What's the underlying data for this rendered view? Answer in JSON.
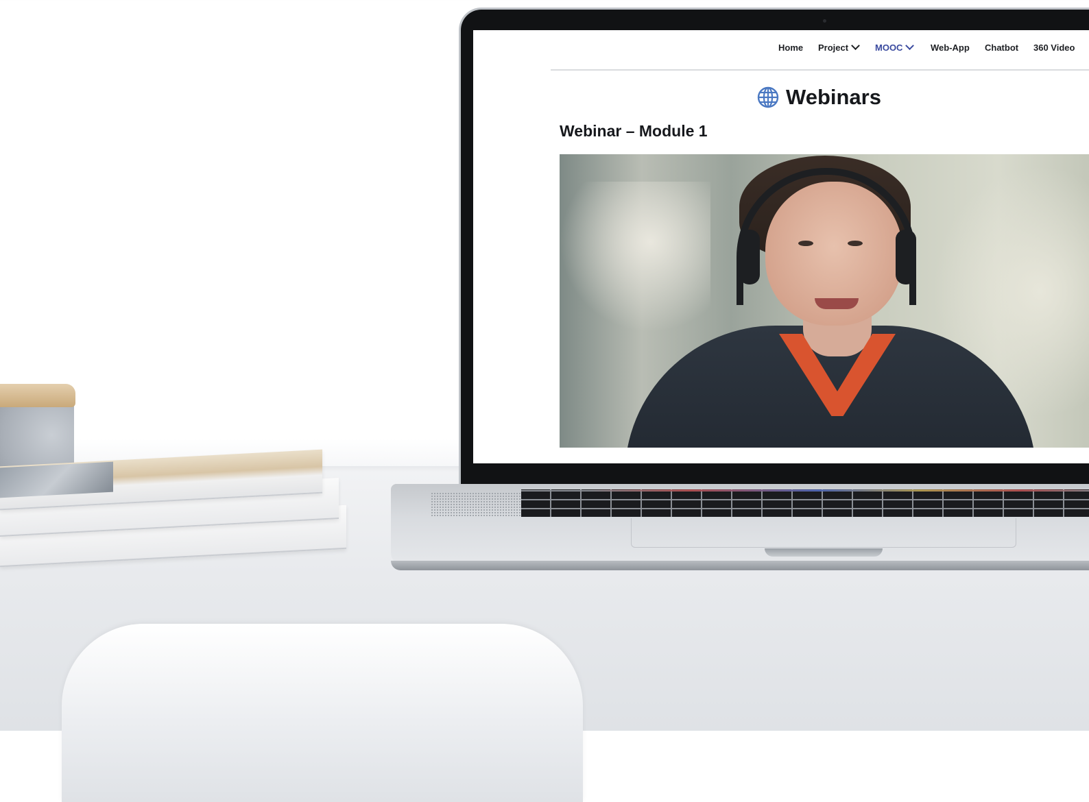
{
  "nav": {
    "items": [
      {
        "label": "Home",
        "has_dropdown": false,
        "active": false
      },
      {
        "label": "Project",
        "has_dropdown": true,
        "active": false
      },
      {
        "label": "MOOC",
        "has_dropdown": true,
        "active": true
      },
      {
        "label": "Web-App",
        "has_dropdown": false,
        "active": false
      },
      {
        "label": "Chatbot",
        "has_dropdown": false,
        "active": false
      },
      {
        "label": "360 Video",
        "has_dropdown": false,
        "active": false
      }
    ]
  },
  "page": {
    "title": "Webinars",
    "title_icon": "globe-icon",
    "section_title": "Webinar – Module 1"
  },
  "colors": {
    "nav_active": "#3a4a9f",
    "globe_icon": "#4a78c2",
    "text": "#16181c"
  }
}
